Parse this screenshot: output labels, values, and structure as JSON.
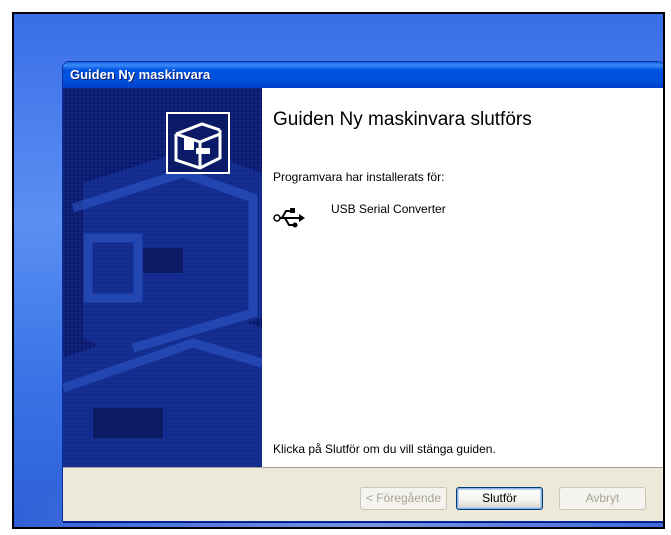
{
  "window": {
    "title": "Guiden Ny maskinvara"
  },
  "content": {
    "heading": "Guiden Ny maskinvara slutförs",
    "installed_label": "Programvara har installerats för:",
    "device_name": "USB Serial Converter",
    "device_icon": "usb-icon",
    "finish_hint": "Klicka på Slutför om du vill stänga guiden."
  },
  "buttons": {
    "back": "< Föregående",
    "finish": "Slutför",
    "cancel": "Avbryt"
  }
}
